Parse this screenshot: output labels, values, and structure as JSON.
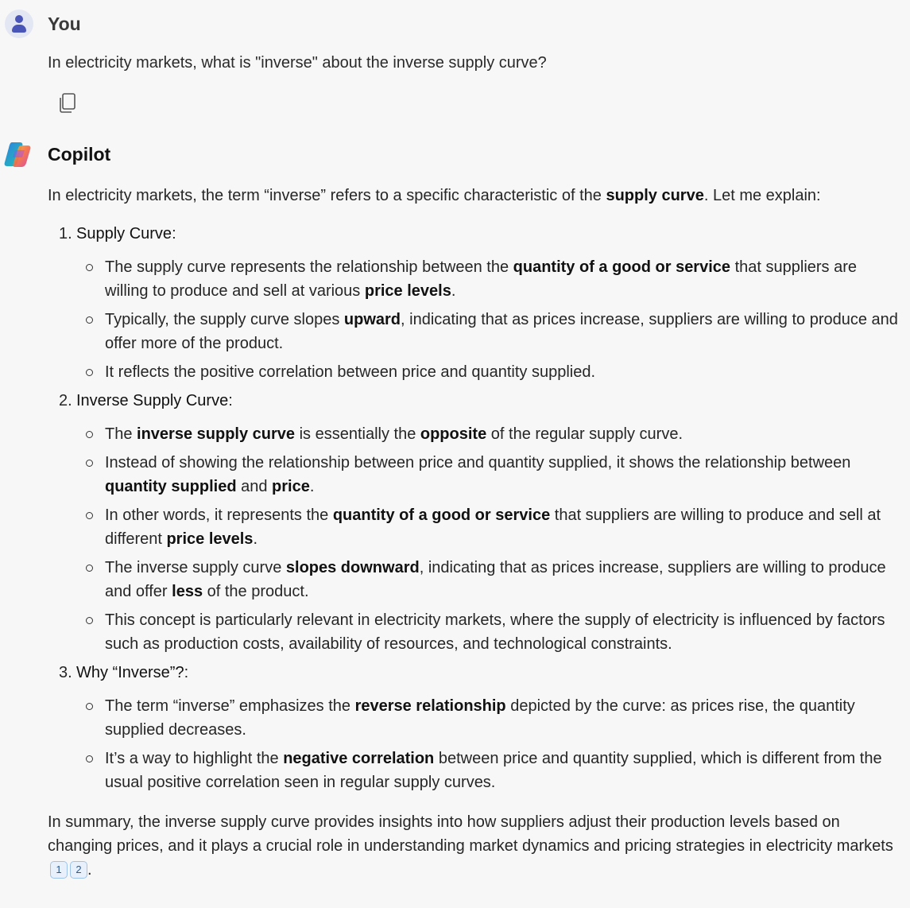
{
  "user": {
    "name": "You",
    "message": "In electricity markets, what is \"inverse\" about the inverse supply curve?"
  },
  "bot": {
    "name": "Copilot",
    "intro": [
      {
        "t": "In electricity markets, the term “inverse” refers to a specific characteristic of the "
      },
      {
        "t": "supply curve",
        "b": true
      },
      {
        "t": ". Let me explain:"
      }
    ],
    "sections": [
      {
        "num": "1.",
        "title": "Supply Curve",
        "title_suffix": ":",
        "bullets": [
          [
            {
              "t": "The supply curve represents the relationship between the "
            },
            {
              "t": "quantity of a good or service",
              "b": true
            },
            {
              "t": " that suppliers are willing to produce and sell at various "
            },
            {
              "t": "price levels",
              "b": true
            },
            {
              "t": "."
            }
          ],
          [
            {
              "t": "Typically, the supply curve slopes "
            },
            {
              "t": "upward",
              "b": true
            },
            {
              "t": ", indicating that as prices increase, suppliers are willing to produce and offer more of the product."
            }
          ],
          [
            {
              "t": "It reflects the positive correlation between price and quantity supplied."
            }
          ]
        ]
      },
      {
        "num": "2.",
        "title": "Inverse Supply Curve",
        "title_suffix": ":",
        "bullets": [
          [
            {
              "t": "The "
            },
            {
              "t": "inverse supply curve",
              "b": true
            },
            {
              "t": " is essentially the "
            },
            {
              "t": "opposite",
              "b": true
            },
            {
              "t": " of the regular supply curve."
            }
          ],
          [
            {
              "t": "Instead of showing the relationship between price and quantity supplied, it shows the relationship between "
            },
            {
              "t": "quantity supplied",
              "b": true
            },
            {
              "t": " and "
            },
            {
              "t": "price",
              "b": true
            },
            {
              "t": "."
            }
          ],
          [
            {
              "t": "In other words, it represents the "
            },
            {
              "t": "quantity of a good or service",
              "b": true
            },
            {
              "t": " that suppliers are willing to produce and sell at different "
            },
            {
              "t": "price levels",
              "b": true
            },
            {
              "t": "."
            }
          ],
          [
            {
              "t": "The inverse supply curve "
            },
            {
              "t": "slopes downward",
              "b": true
            },
            {
              "t": ", indicating that as prices increase, suppliers are willing to produce and offer "
            },
            {
              "t": "less",
              "b": true
            },
            {
              "t": " of the product."
            }
          ],
          [
            {
              "t": "This concept is particularly relevant in electricity markets, where the supply of electricity is influenced by factors such as production costs, availability of resources, and technological constraints."
            }
          ]
        ]
      },
      {
        "num": "3.",
        "title": "Why “Inverse”?",
        "title_suffix": ":",
        "bullets": [
          [
            {
              "t": "The term “inverse” emphasizes the "
            },
            {
              "t": "reverse relationship",
              "b": true
            },
            {
              "t": " depicted by the curve: as prices rise, the quantity supplied decreases."
            }
          ],
          [
            {
              "t": "It’s a way to highlight the "
            },
            {
              "t": "negative correlation",
              "b": true
            },
            {
              "t": " between price and quantity supplied, which is different from the usual positive correlation seen in regular supply curves."
            }
          ]
        ]
      }
    ],
    "summary": "In summary, the inverse supply curve provides insights into how suppliers adjust their production levels based on changing prices, and it plays a crucial role in understanding market dynamics and pricing strategies in electricity markets",
    "citations": [
      "1",
      "2"
    ],
    "summary_end": "."
  },
  "icons": {
    "copy": "copy-icon",
    "user_avatar": "user-avatar",
    "copilot_logo": "copilot-logo"
  }
}
